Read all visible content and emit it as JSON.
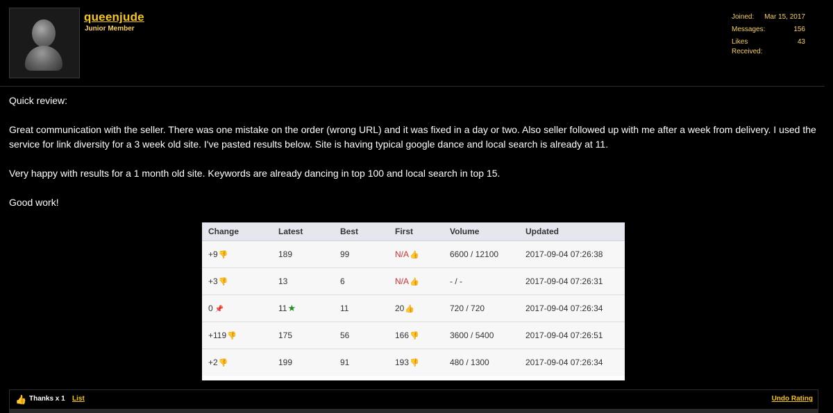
{
  "user": {
    "name": "queenjude",
    "title": "Junior Member",
    "joined_label": "Joined:",
    "joined_value": "Mar 15, 2017",
    "messages_label": "Messages:",
    "messages_value": "156",
    "likes_label": "Likes Received:",
    "likes_value": "43"
  },
  "post": {
    "paragraphs": [
      "Quick review:",
      "Great communication with the seller. There was one mistake on the order (wrong URL) and it was fixed in a day or two. Also seller followed up with me after a week from delivery. I used the service for link diversity for a 3 week old site. I've pasted results below. Site is having typical google dance and local search is already at 11.",
      "Very happy with results for a 1 month old site. Keywords are already dancing in top 100 and local search in top 15.",
      "Good work!"
    ]
  },
  "table": {
    "headers": [
      "Change",
      "Latest",
      "Best",
      "First",
      "Volume",
      "Updated"
    ],
    "rows": [
      {
        "change": "+9",
        "change_icon": "thumb-down-icon",
        "latest": "189",
        "latest_icon": "",
        "best": "99",
        "first": "N/A",
        "first_red": true,
        "first_icon": "thumb-up-icon",
        "volume": "6600 / 12100",
        "updated": "2017-09-04 07:26:38"
      },
      {
        "change": "+3",
        "change_icon": "thumb-down-icon",
        "latest": "13",
        "latest_icon": "",
        "best": "6",
        "first": "N/A",
        "first_red": true,
        "first_icon": "thumb-up-icon",
        "volume": "- / -",
        "updated": "2017-09-04 07:26:31"
      },
      {
        "change": "0",
        "change_icon": "pin-icon",
        "latest": "11",
        "latest_icon": "star-icon",
        "best": "11",
        "first": "20",
        "first_red": false,
        "first_icon": "thumb-up-icon",
        "volume": "720 / 720",
        "updated": "2017-09-04 07:26:34"
      },
      {
        "change": "+119",
        "change_icon": "thumb-down-icon",
        "latest": "175",
        "latest_icon": "",
        "best": "56",
        "first": "166",
        "first_red": false,
        "first_icon": "thumb-down-icon",
        "volume": "3600 / 5400",
        "updated": "2017-09-04 07:26:51"
      },
      {
        "change": "+2",
        "change_icon": "thumb-down-icon",
        "latest": "199",
        "latest_icon": "",
        "best": "91",
        "first": "193",
        "first_red": false,
        "first_icon": "thumb-down-icon",
        "volume": "480 / 1300",
        "updated": "2017-09-04 07:26:34"
      }
    ]
  },
  "footer": {
    "thanks_text": "Thanks x 1",
    "list_label": "List",
    "undo_label": "Undo Rating"
  },
  "colors": {
    "accent": "#f6c90e",
    "red": "#d32f2f",
    "green": "#2a9d2a"
  }
}
